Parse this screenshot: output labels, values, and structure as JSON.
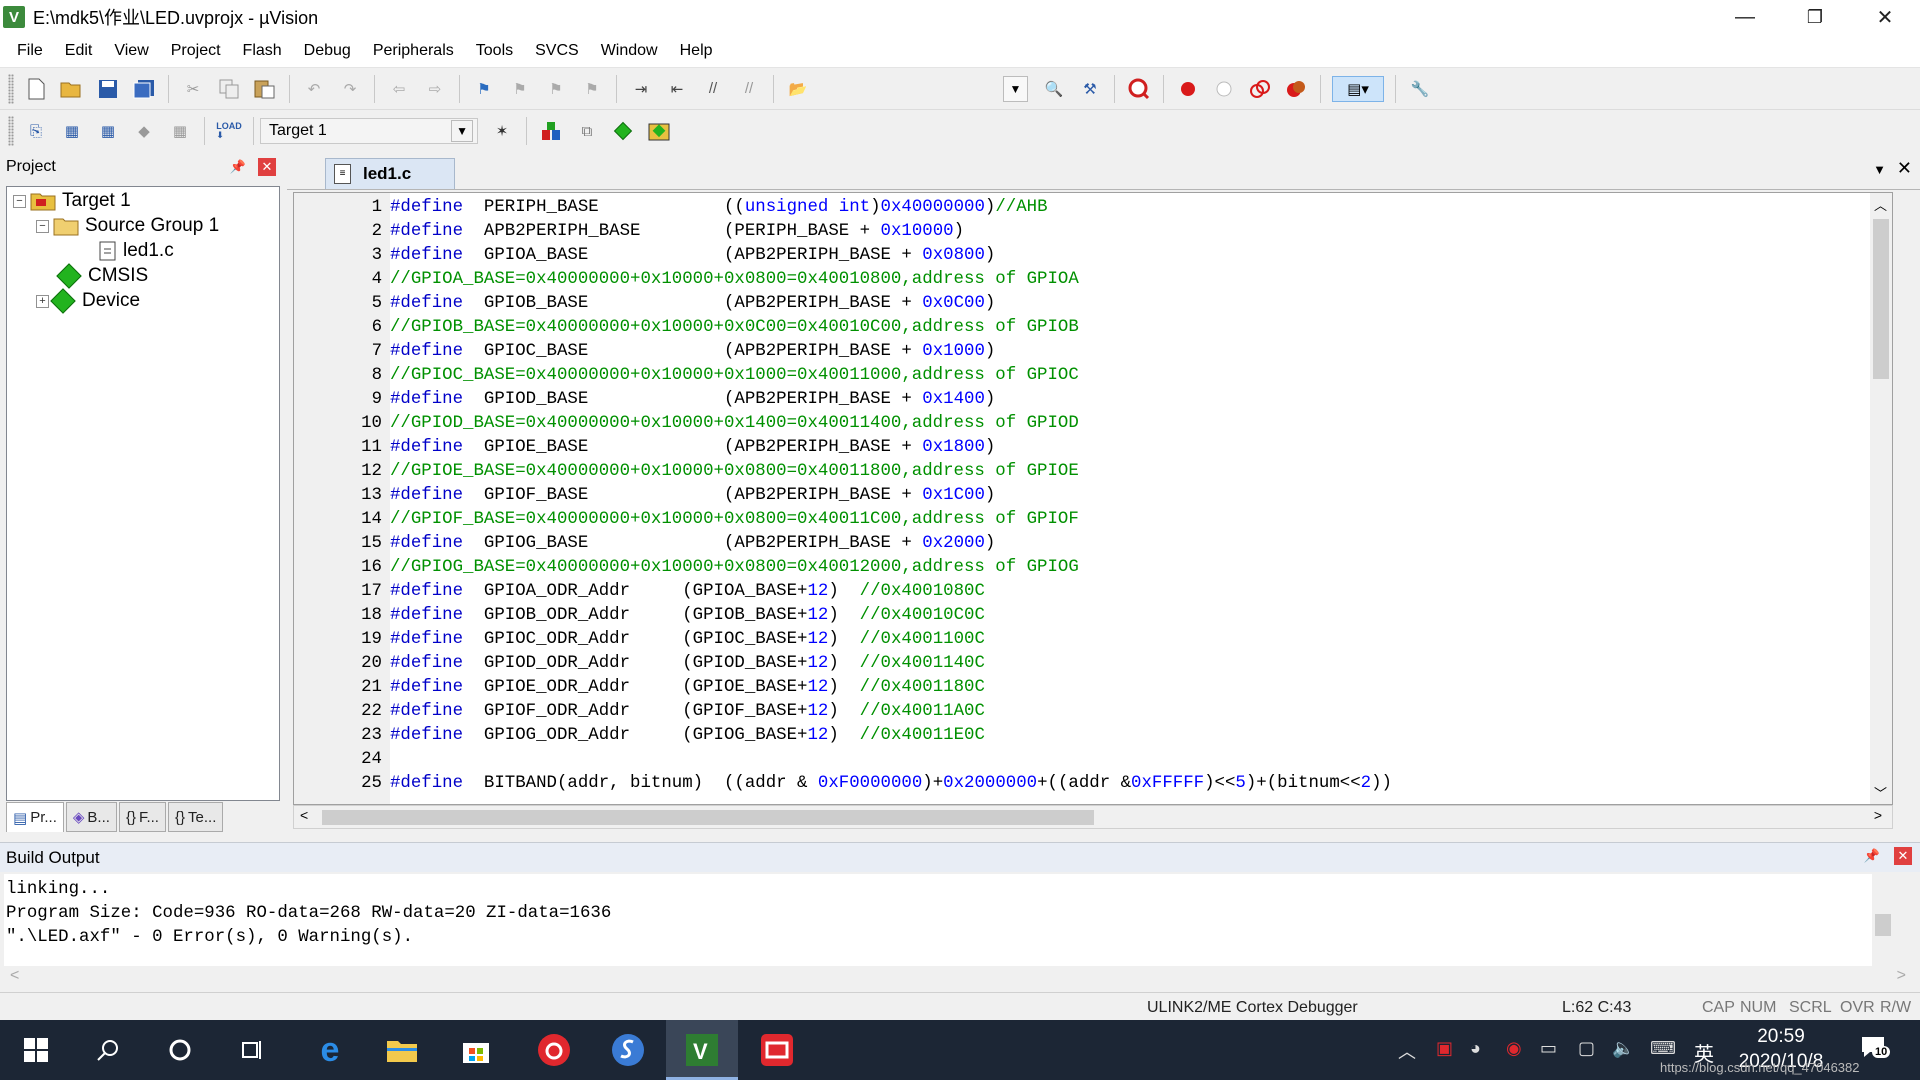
{
  "window": {
    "title": "E:\\mdk5\\作业\\LED.uvprojx - µVision",
    "app_icon": "V",
    "min_label": "—",
    "max_label": "❐",
    "close_label": "✕"
  },
  "menu": [
    "File",
    "Edit",
    "View",
    "Project",
    "Flash",
    "Debug",
    "Peripherals",
    "Tools",
    "SVCS",
    "Window",
    "Help"
  ],
  "toolbar": {
    "target_value": "Target 1"
  },
  "project": {
    "title": "Project",
    "tree": {
      "root": "Target 1",
      "group": "Source Group 1",
      "file": "led1.c",
      "cmsis": "CMSIS",
      "device": "Device"
    },
    "tabs": [
      "Pr...",
      "B...",
      "F...",
      "Te..."
    ]
  },
  "editor": {
    "tab_label": "led1.c",
    "lines": [
      {
        "n": "1",
        "segs": [
          [
            "pp",
            "#define"
          ],
          [
            "",
            "  PERIPH_BASE            (("
          ],
          [
            "kw",
            "unsigned int"
          ],
          [
            "",
            ")"
          ],
          [
            "num",
            "0x40000000"
          ],
          [
            "",
            ")"
          ],
          [
            "cm",
            "//AHB"
          ]
        ]
      },
      {
        "n": "2",
        "segs": [
          [
            "pp",
            "#define"
          ],
          [
            "",
            "  APB2PERIPH_BASE        (PERIPH_BASE + "
          ],
          [
            "num",
            "0x10000"
          ],
          [
            "",
            ")"
          ]
        ]
      },
      {
        "n": "3",
        "segs": [
          [
            "pp",
            "#define"
          ],
          [
            "",
            "  GPIOA_BASE             (APB2PERIPH_BASE + "
          ],
          [
            "num",
            "0x0800"
          ],
          [
            "",
            ")"
          ]
        ]
      },
      {
        "n": "4",
        "segs": [
          [
            "cm",
            "//GPIOA_BASE=0x40000000+0x10000+0x0800=0x40010800,address of GPIOA"
          ]
        ]
      },
      {
        "n": "5",
        "segs": [
          [
            "pp",
            "#define"
          ],
          [
            "",
            "  GPIOB_BASE             (APB2PERIPH_BASE + "
          ],
          [
            "num",
            "0x0C00"
          ],
          [
            "",
            ")"
          ]
        ]
      },
      {
        "n": "6",
        "segs": [
          [
            "cm",
            "//GPIOB_BASE=0x40000000+0x10000+0x0C00=0x40010C00,address of GPIOB"
          ]
        ]
      },
      {
        "n": "7",
        "segs": [
          [
            "pp",
            "#define"
          ],
          [
            "",
            "  GPIOC_BASE             (APB2PERIPH_BASE + "
          ],
          [
            "num",
            "0x1000"
          ],
          [
            "",
            ")"
          ]
        ]
      },
      {
        "n": "8",
        "segs": [
          [
            "cm",
            "//GPIOC_BASE=0x40000000+0x10000+0x1000=0x40011000,address of GPIOC"
          ]
        ]
      },
      {
        "n": "9",
        "segs": [
          [
            "pp",
            "#define"
          ],
          [
            "",
            "  GPIOD_BASE             (APB2PERIPH_BASE + "
          ],
          [
            "num",
            "0x1400"
          ],
          [
            "",
            ")"
          ]
        ]
      },
      {
        "n": "10",
        "segs": [
          [
            "cm",
            "//GPIOD_BASE=0x40000000+0x10000+0x1400=0x40011400,address of GPIOD"
          ]
        ]
      },
      {
        "n": "11",
        "segs": [
          [
            "pp",
            "#define"
          ],
          [
            "",
            "  GPIOE_BASE             (APB2PERIPH_BASE + "
          ],
          [
            "num",
            "0x1800"
          ],
          [
            "",
            ")"
          ]
        ]
      },
      {
        "n": "12",
        "segs": [
          [
            "cm",
            "//GPIOE_BASE=0x40000000+0x10000+0x0800=0x40011800,address of GPIOE"
          ]
        ]
      },
      {
        "n": "13",
        "segs": [
          [
            "pp",
            "#define"
          ],
          [
            "",
            "  GPIOF_BASE             (APB2PERIPH_BASE + "
          ],
          [
            "num",
            "0x1C00"
          ],
          [
            "",
            ")"
          ]
        ]
      },
      {
        "n": "14",
        "segs": [
          [
            "cm",
            "//GPIOF_BASE=0x40000000+0x10000+0x0800=0x40011C00,address of GPIOF"
          ]
        ]
      },
      {
        "n": "15",
        "segs": [
          [
            "pp",
            "#define"
          ],
          [
            "",
            "  GPIOG_BASE             (APB2PERIPH_BASE + "
          ],
          [
            "num",
            "0x2000"
          ],
          [
            "",
            ")"
          ]
        ]
      },
      {
        "n": "16",
        "segs": [
          [
            "cm",
            "//GPIOG_BASE=0x40000000+0x10000+0x0800=0x40012000,address of GPIOG"
          ]
        ]
      },
      {
        "n": "17",
        "segs": [
          [
            "pp",
            "#define"
          ],
          [
            "",
            "  GPIOA_ODR_Addr     (GPIOA_BASE+"
          ],
          [
            "num",
            "12"
          ],
          [
            "",
            ")  "
          ],
          [
            "cm",
            "//0x4001080C"
          ]
        ]
      },
      {
        "n": "18",
        "segs": [
          [
            "pp",
            "#define"
          ],
          [
            "",
            "  GPIOB_ODR_Addr     (GPIOB_BASE+"
          ],
          [
            "num",
            "12"
          ],
          [
            "",
            ")  "
          ],
          [
            "cm",
            "//0x40010C0C"
          ]
        ]
      },
      {
        "n": "19",
        "segs": [
          [
            "pp",
            "#define"
          ],
          [
            "",
            "  GPIOC_ODR_Addr     (GPIOC_BASE+"
          ],
          [
            "num",
            "12"
          ],
          [
            "",
            ")  "
          ],
          [
            "cm",
            "//0x4001100C"
          ]
        ]
      },
      {
        "n": "20",
        "segs": [
          [
            "pp",
            "#define"
          ],
          [
            "",
            "  GPIOD_ODR_Addr     (GPIOD_BASE+"
          ],
          [
            "num",
            "12"
          ],
          [
            "",
            ")  "
          ],
          [
            "cm",
            "//0x4001140C"
          ]
        ]
      },
      {
        "n": "21",
        "segs": [
          [
            "pp",
            "#define"
          ],
          [
            "",
            "  GPIOE_ODR_Addr     (GPIOE_BASE+"
          ],
          [
            "num",
            "12"
          ],
          [
            "",
            ")  "
          ],
          [
            "cm",
            "//0x4001180C"
          ]
        ]
      },
      {
        "n": "22",
        "segs": [
          [
            "pp",
            "#define"
          ],
          [
            "",
            "  GPIOF_ODR_Addr     (GPIOF_BASE+"
          ],
          [
            "num",
            "12"
          ],
          [
            "",
            ")  "
          ],
          [
            "cm",
            "//0x40011A0C"
          ]
        ]
      },
      {
        "n": "23",
        "segs": [
          [
            "pp",
            "#define"
          ],
          [
            "",
            "  GPIOG_ODR_Addr     (GPIOG_BASE+"
          ],
          [
            "num",
            "12"
          ],
          [
            "",
            ")  "
          ],
          [
            "cm",
            "//0x40011E0C"
          ]
        ]
      },
      {
        "n": "24",
        "segs": []
      },
      {
        "n": "25",
        "segs": [
          [
            "pp",
            "#define"
          ],
          [
            "",
            "  BITBAND(addr, bitnum)  ((addr & "
          ],
          [
            "num",
            "0xF0000000"
          ],
          [
            "",
            ")+"
          ],
          [
            "num",
            "0x2000000"
          ],
          [
            "",
            "+((addr &"
          ],
          [
            "num",
            "0xFFFFF"
          ],
          [
            "",
            ")<<"
          ],
          [
            "num",
            "5"
          ],
          [
            "",
            ")+(bitnum<<"
          ],
          [
            "num",
            "2"
          ],
          [
            "",
            "))"
          ]
        ]
      }
    ]
  },
  "build": {
    "title": "Build Output",
    "lines": [
      "linking...",
      "Program Size: Code=936 RO-data=268 RW-data=20 ZI-data=1636",
      "\".\\LED.axf\" - 0 Error(s), 0 Warning(s)."
    ]
  },
  "status": {
    "debugger": "ULINK2/ME Cortex Debugger",
    "cursor": "L:62 C:43",
    "cap": "CAP",
    "num": "NUM",
    "scrl": "SCRL",
    "ovr": "OVR",
    "rw": "R/W"
  },
  "taskbar": {
    "time": "20:59",
    "date": "2020/10/8",
    "ime": "英",
    "notification_count": "10",
    "watermark": "https://blog.csdn.net/qq_47046382",
    "colors": {
      "accent": "#8fb2e3",
      "background": "#1c2635"
    }
  }
}
